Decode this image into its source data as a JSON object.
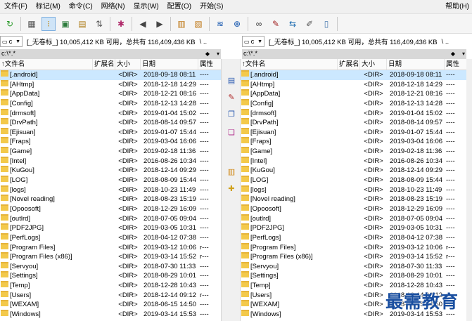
{
  "menu": {
    "items": [
      "文件(F)",
      "标记(M)",
      "命令(C)",
      "网络(N)",
      "显示(W)",
      "配置(O)",
      "开始(S)"
    ],
    "help": "帮助(H)"
  },
  "toolbar": {
    "icons": [
      "refresh-icon",
      "grid-view-icon",
      "tree-view-icon",
      "thumbnail-view-icon",
      "folder-compare-icon",
      "folder-sync-icon",
      "unpack-icon",
      "back-arrow-icon",
      "forward-arrow-icon",
      "pack-icon",
      "unpack-archive-icon",
      "ftp-icon",
      "url-icon",
      "binoculars-icon",
      "multi-rename-icon",
      "sync-dirs-icon",
      "edit-icon",
      "notepad-icon"
    ]
  },
  "left": {
    "drive": "c",
    "drive_info": "[_无卷标_]  10,005,412 KB 可用，总共有 116,409,436 KB",
    "nav": "\\  ..",
    "path": "c:\\*.*",
    "sort_marker": "▾"
  },
  "right": {
    "drive": "c",
    "drive_info": "[_无卷标_]  10,005,412 KB 可用，总共有 116,409,436 KB",
    "nav": "\\  ..",
    "path": "c:\\*.*",
    "sort_marker": "▾"
  },
  "columns": {
    "name": "↑文件名",
    "ext": "扩展名",
    "size": "大小",
    "date": "日期",
    "attr": "属性"
  },
  "files": [
    {
      "name": "[.android]",
      "size": "<DIR>",
      "date": "2018-09-18 08:11",
      "attr": "----"
    },
    {
      "name": "[AHtmp]",
      "size": "<DIR>",
      "date": "2018-12-18 14:29",
      "attr": "----"
    },
    {
      "name": "[AppData]",
      "size": "<DIR>",
      "date": "2018-12-21 08:16",
      "attr": "----"
    },
    {
      "name": "[Config]",
      "size": "<DIR>",
      "date": "2018-12-13 14:28",
      "attr": "----"
    },
    {
      "name": "[drmsoft]",
      "size": "<DIR>",
      "date": "2019-01-04 15:02",
      "attr": "----"
    },
    {
      "name": "[DrvPath]",
      "size": "<DIR>",
      "date": "2018-08-14 09:57",
      "attr": "----"
    },
    {
      "name": "[Ejisuan]",
      "size": "<DIR>",
      "date": "2019-01-07 15:44",
      "attr": "----"
    },
    {
      "name": "[Fraps]",
      "size": "<DIR>",
      "date": "2019-03-04 16:06",
      "attr": "----"
    },
    {
      "name": "[Game]",
      "size": "<DIR>",
      "date": "2019-02-18 11:36",
      "attr": "----"
    },
    {
      "name": "[Intel]",
      "size": "<DIR>",
      "date": "2016-08-26 10:34",
      "attr": "----"
    },
    {
      "name": "[KuGou]",
      "size": "<DIR>",
      "date": "2018-12-14 09:29",
      "attr": "----"
    },
    {
      "name": "[LOG]",
      "size": "<DIR>",
      "date": "2018-08-09 15:44",
      "attr": "----"
    },
    {
      "name": "[logs]",
      "size": "<DIR>",
      "date": "2018-10-23 11:49",
      "attr": "----"
    },
    {
      "name": "[Novel reading]",
      "size": "<DIR>",
      "date": "2018-08-23 15:19",
      "attr": "----"
    },
    {
      "name": "[Opoosoft]",
      "size": "<DIR>",
      "date": "2018-12-29 16:09",
      "attr": "----"
    },
    {
      "name": "[outlrd]",
      "size": "<DIR>",
      "date": "2018-07-05 09:04",
      "attr": "----"
    },
    {
      "name": "[PDF2JPG]",
      "size": "<DIR>",
      "date": "2019-03-05 10:31",
      "attr": "----"
    },
    {
      "name": "[PerfLogs]",
      "size": "<DIR>",
      "date": "2018-04-12 07:38",
      "attr": "----"
    },
    {
      "name": "[Program Files]",
      "size": "<DIR>",
      "date": "2019-03-12 10:06",
      "attr": "r---"
    },
    {
      "name": "[Program Files (x86)]",
      "size": "<DIR>",
      "date": "2019-03-14 15:52",
      "attr": "r---"
    },
    {
      "name": "[Servyou]",
      "size": "<DIR>",
      "date": "2018-07-30 11:33",
      "attr": "----"
    },
    {
      "name": "[Settings]",
      "size": "<DIR>",
      "date": "2018-08-29 10:01",
      "attr": "----"
    },
    {
      "name": "[Temp]",
      "size": "<DIR>",
      "date": "2018-12-28 10:43",
      "attr": "----"
    },
    {
      "name": "[Users]",
      "size": "<DIR>",
      "date": "2018-12-14 09:12",
      "attr": "r---"
    },
    {
      "name": "[WEXAM]",
      "size": "<DIR>",
      "date": "2018-06-15 14:50",
      "attr": "----"
    },
    {
      "name": "[Windows]",
      "size": "<DIR>",
      "date": "2019-03-14 15:53",
      "attr": "----"
    }
  ],
  "middle_buttons": [
    "view-file-icon",
    "edit-file-icon",
    "copy-icon",
    "move-icon",
    "pack-icon",
    "new-folder-icon"
  ],
  "watermark": "最需教育"
}
